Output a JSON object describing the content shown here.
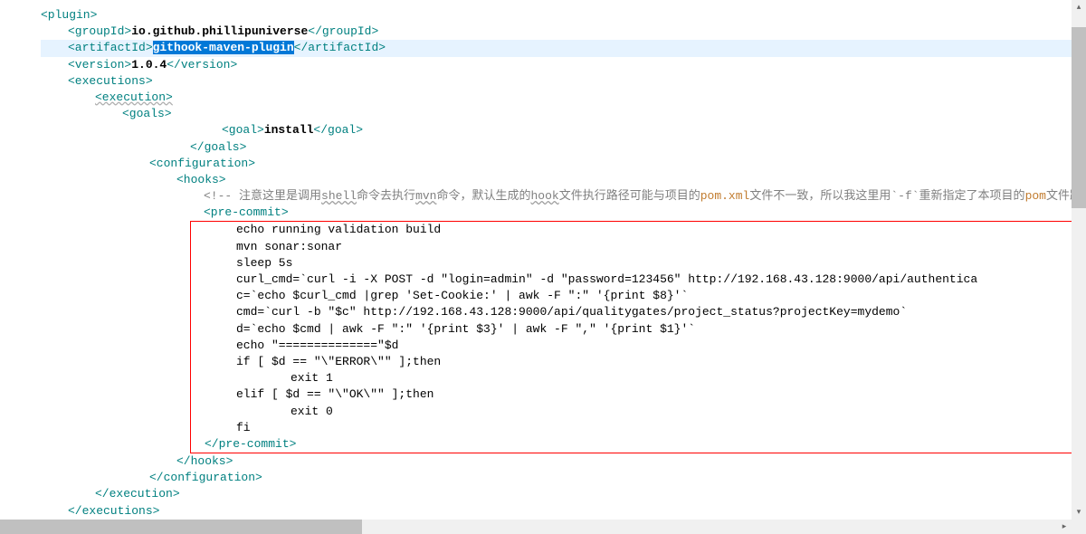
{
  "tags": {
    "plugin_open": "<plugin>",
    "plugin_close": "</plugin>",
    "groupId_open": "<groupId>",
    "groupId_close": "</groupId>",
    "artifactId_open": "<artifactId>",
    "artifactId_close": "</artifactId>",
    "version_open": "<version>",
    "version_close": "</version>",
    "executions_open": "<executions>",
    "executions_close": "</executions>",
    "execution_open": "<execution>",
    "execution_close": "</execution>",
    "goals_open": "<goals>",
    "goals_close": "</goals>",
    "goal_open": "<goal>",
    "goal_close": "</goal>",
    "configuration_open": "<configuration>",
    "configuration_close": "</configuration>",
    "hooks_open": "<hooks>",
    "hooks_close": "</hooks>",
    "precommit_open": "<pre-commit>",
    "precommit_close": "</pre-commit>",
    "comment_start": "<!-- "
  },
  "values": {
    "groupId": "io.github.phillipuniverse",
    "artifactId": "githook-maven-plugin",
    "version": "1.0.4",
    "goal": "install"
  },
  "comment": {
    "prefix": "注意这里是调用",
    "shell": "shell",
    "mid1": "命令去执行",
    "mvn": "mvn",
    "mid2": "命令，默认生成的",
    "hook": "hook",
    "mid3": "文件执行路径可能与项目的",
    "pom1": "pom.xml",
    "mid4": "文件不一致，所以我这里用`",
    "flag": "-f",
    "mid5": "`重新指定了本项目的",
    "pom2": "pom",
    "suffix": "文件路径"
  },
  "script": {
    "l1": "echo running validation build",
    "l2": "mvn sonar:sonar",
    "l3": "sleep 5s",
    "l4": "curl_cmd=`curl -i -X POST -d \"login=admin\" -d \"password=123456\" http://192.168.43.128:9000/api/authentica",
    "l5": "c=`echo $curl_cmd |grep 'Set-Cookie:' | awk -F \":\" '{print $8}'`",
    "l6": "cmd=`curl -b \"$c\" http://192.168.43.128:9000/api/qualitygates/project_status?projectKey=mydemo`",
    "l7": "d=`echo $cmd | awk -F \":\" '{print $3}' | awk -F \",\" '{print $1}'`",
    "l8": "echo \"==============\"$d",
    "l9": "if [ $d == \"\\\"ERROR\\\"\" ];then",
    "l10": "exit 1",
    "l11": "elif [ $d == \"\\\"OK\\\"\" ];then",
    "l12": "exit 0",
    "l13": "fi"
  }
}
